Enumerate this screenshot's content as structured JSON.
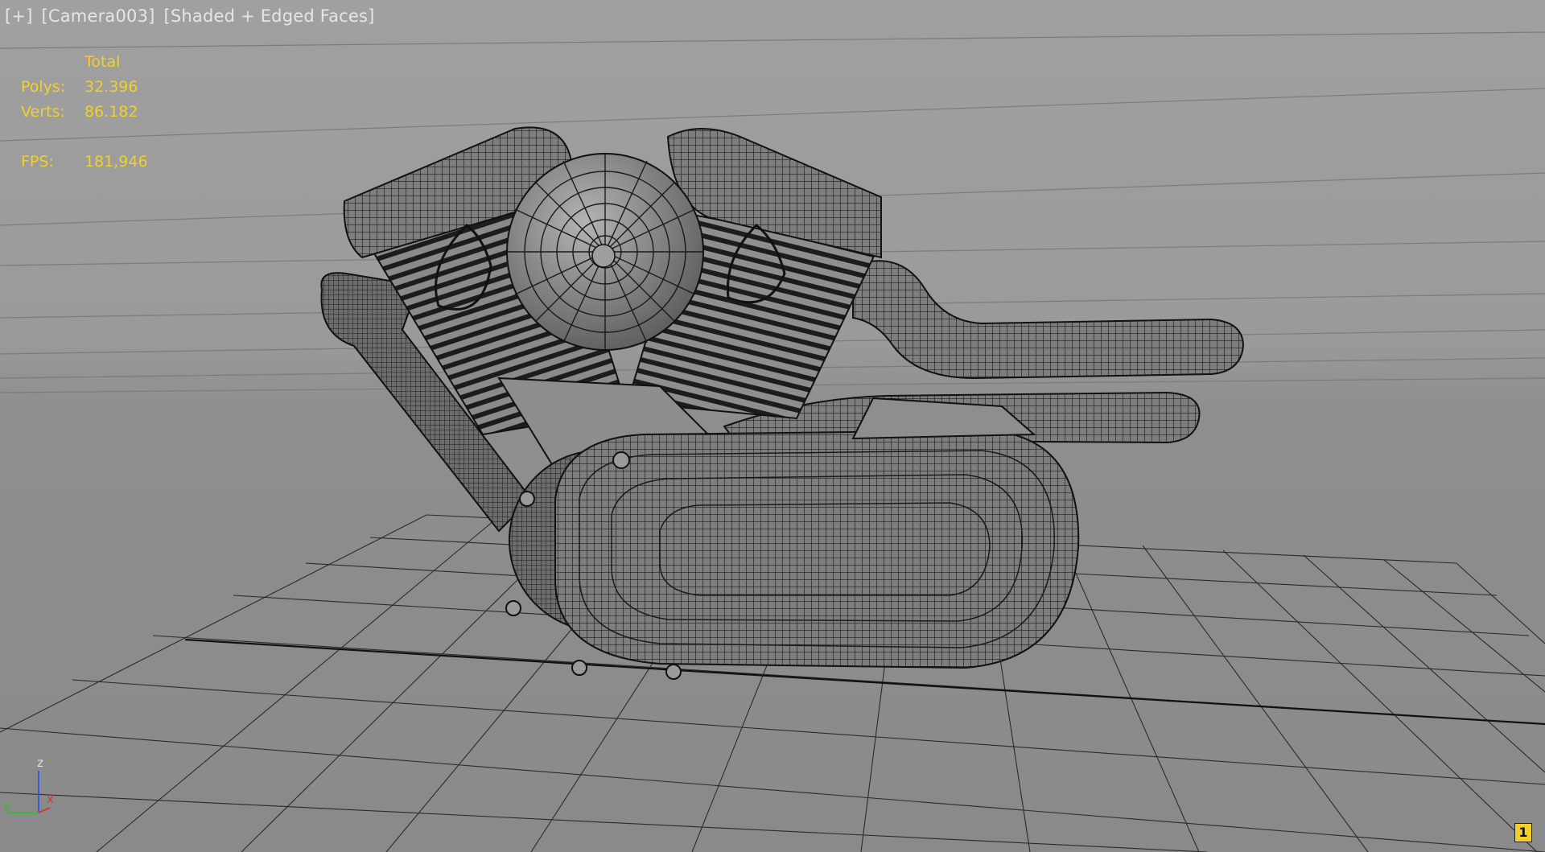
{
  "viewport": {
    "menu_label": "[+]",
    "camera_label": "[Camera003]",
    "shading_label": "[Shaded + Edged Faces]",
    "background_color": "#9a9a9a",
    "grid_color": "#1e1e1e"
  },
  "stats": {
    "header": "Total",
    "polys_label": "Polys:",
    "polys_value": "32.396",
    "verts_label": "Verts:",
    "verts_value": "86.182",
    "fps_label": "FPS:",
    "fps_value": "181,946",
    "text_color": "#f2cf2a"
  },
  "axis": {
    "z_label": "z",
    "x_label": "x",
    "y_label": "y",
    "x_color": "#d23b2b",
    "y_color": "#3ab83a",
    "z_color": "#3a5bd8"
  },
  "badge": {
    "label": "1"
  },
  "model": {
    "object": "v-twin-engine",
    "shading": "shaded-edged-faces"
  }
}
